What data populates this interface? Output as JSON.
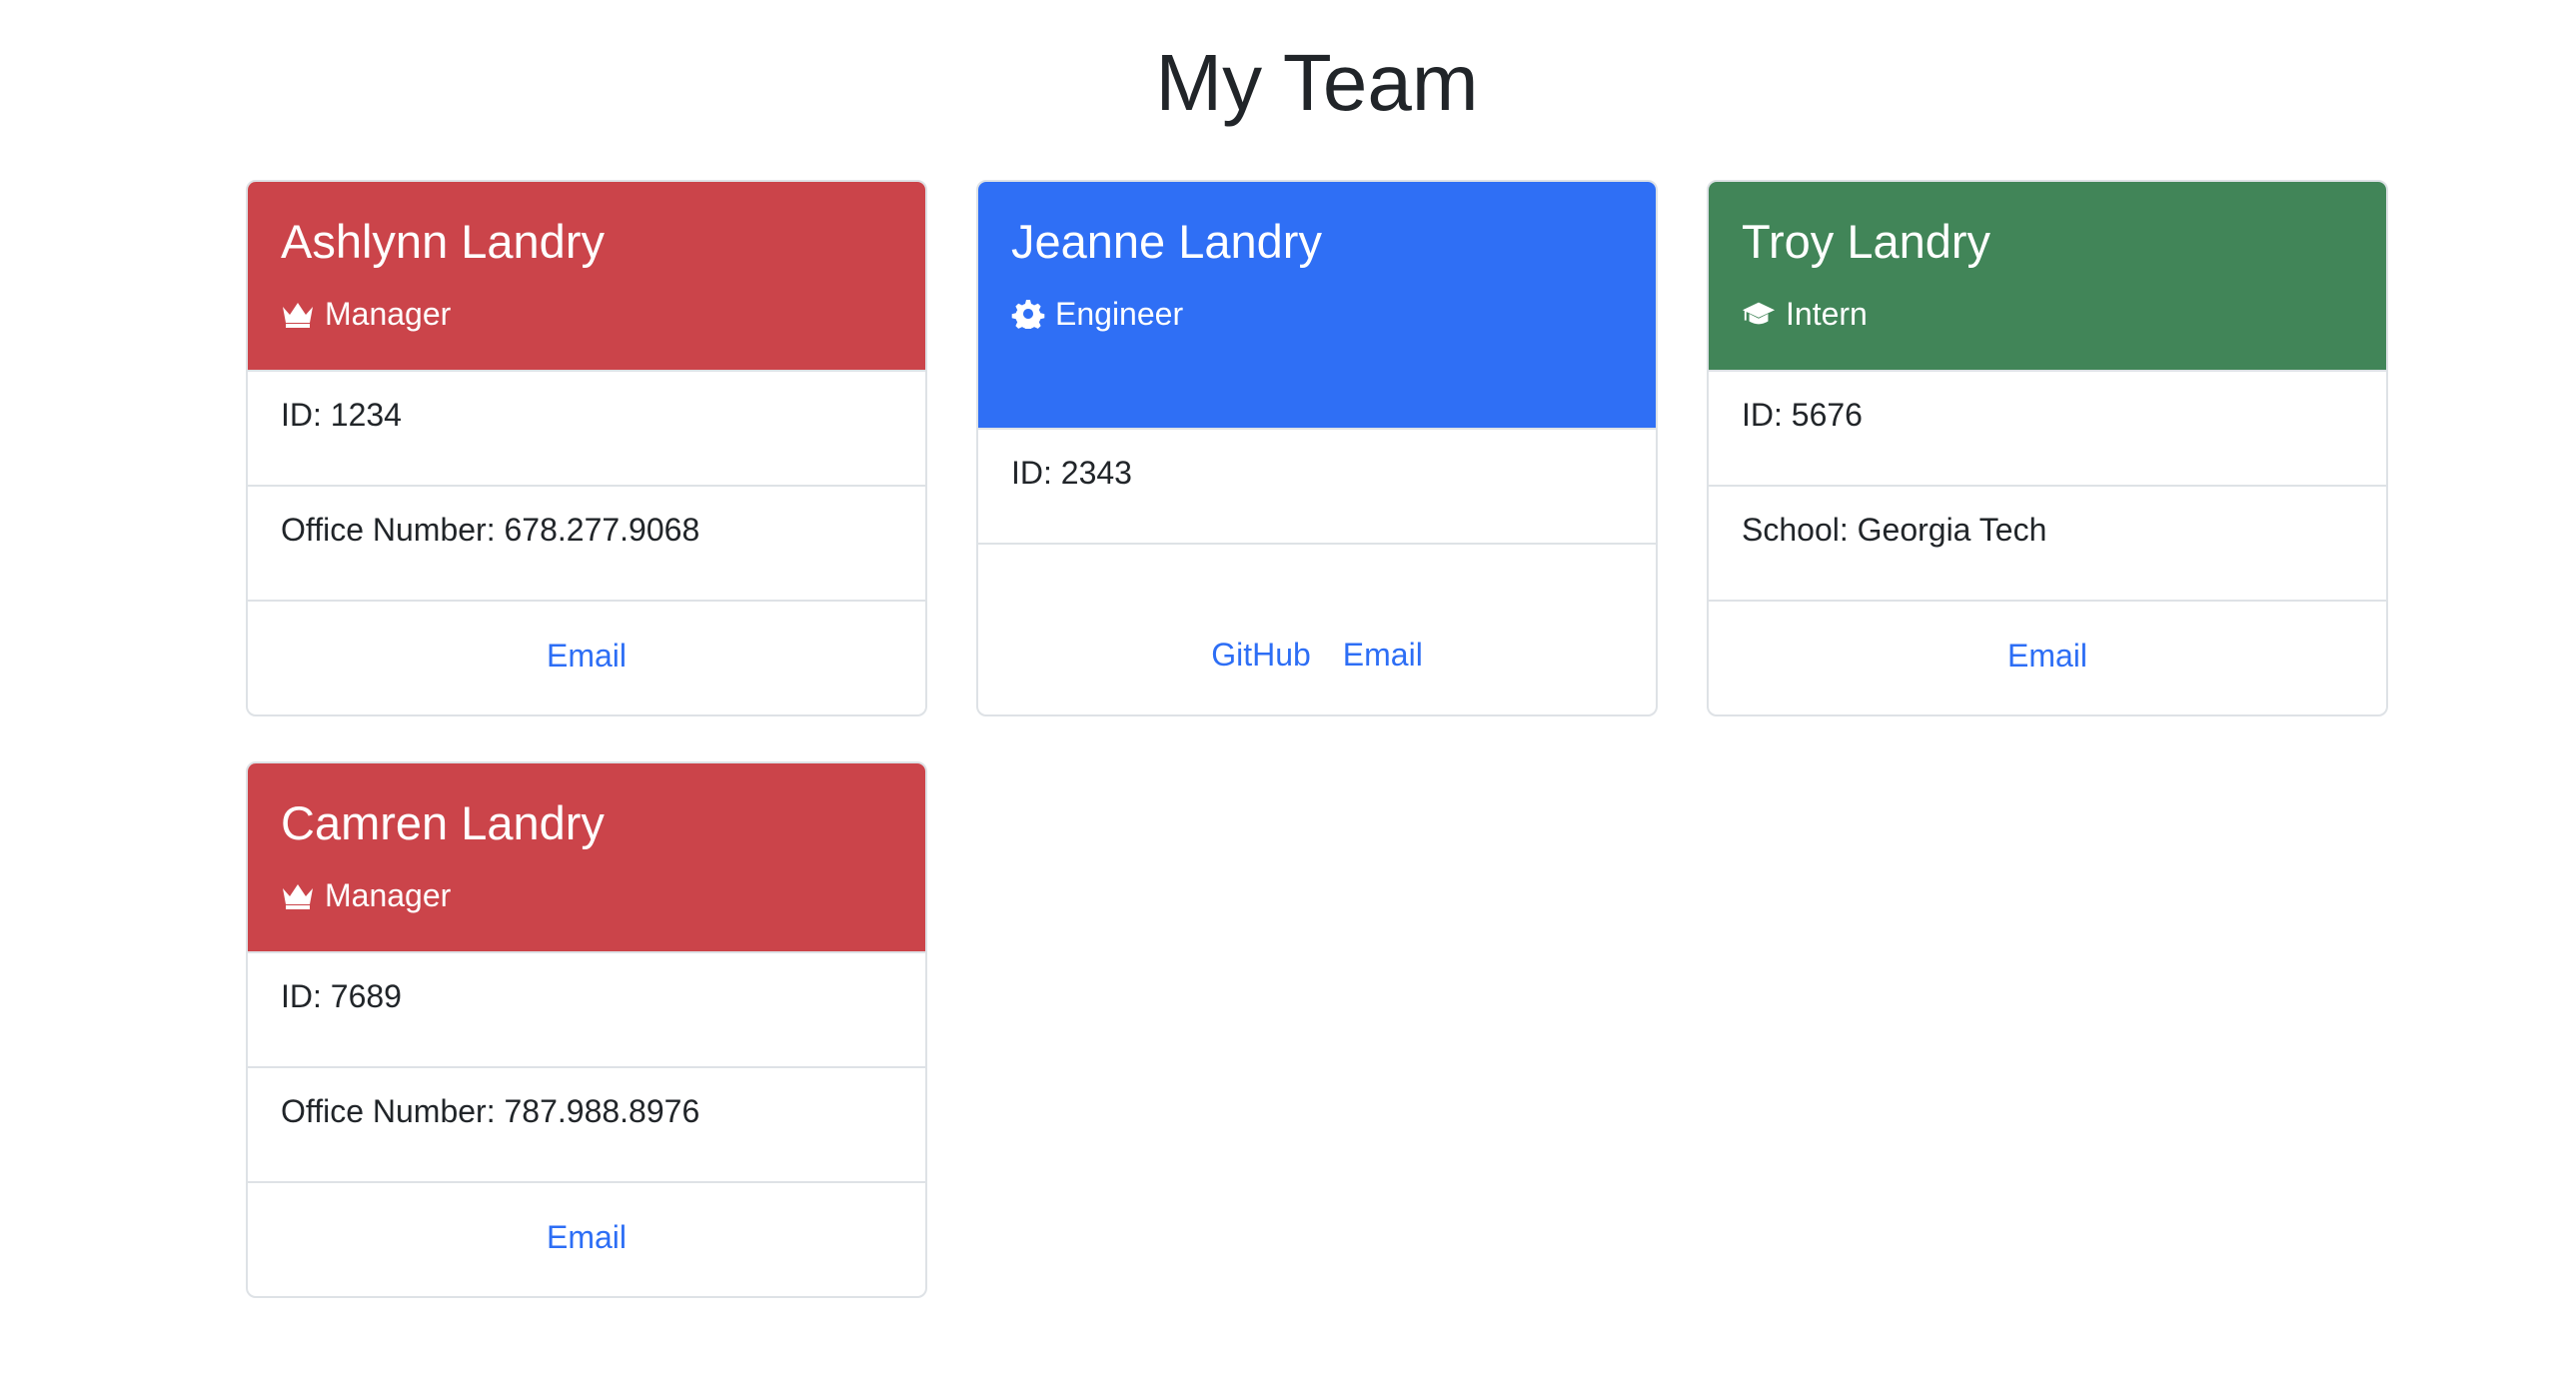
{
  "page": {
    "title": "My Team"
  },
  "colors": {
    "manager": "#cb444a",
    "engineer": "#2f6ff5",
    "intern": "#418558",
    "link": "#2d6ef5"
  },
  "cards": [
    {
      "name": "Ashlynn Landry",
      "role": "Manager",
      "icon": "crown-icon",
      "rows": [
        "ID: 1234",
        "Office Number: 678.277.9068"
      ],
      "links": [
        "Email"
      ]
    },
    {
      "name": "Jeanne Landry",
      "role": "Engineer",
      "icon": "gear-icon",
      "rows": [
        "ID: 2343",
        ""
      ],
      "links": [
        "GitHub",
        "Email"
      ]
    },
    {
      "name": "Troy Landry",
      "role": "Intern",
      "icon": "graduation-cap-icon",
      "rows": [
        "ID: 5676",
        "School: Georgia Tech"
      ],
      "links": [
        "Email"
      ]
    },
    {
      "name": "Camren Landry",
      "role": "Manager",
      "icon": "crown-icon",
      "rows": [
        "ID: 7689",
        "Office Number: 787.988.8976"
      ],
      "links": [
        "Email"
      ]
    }
  ]
}
